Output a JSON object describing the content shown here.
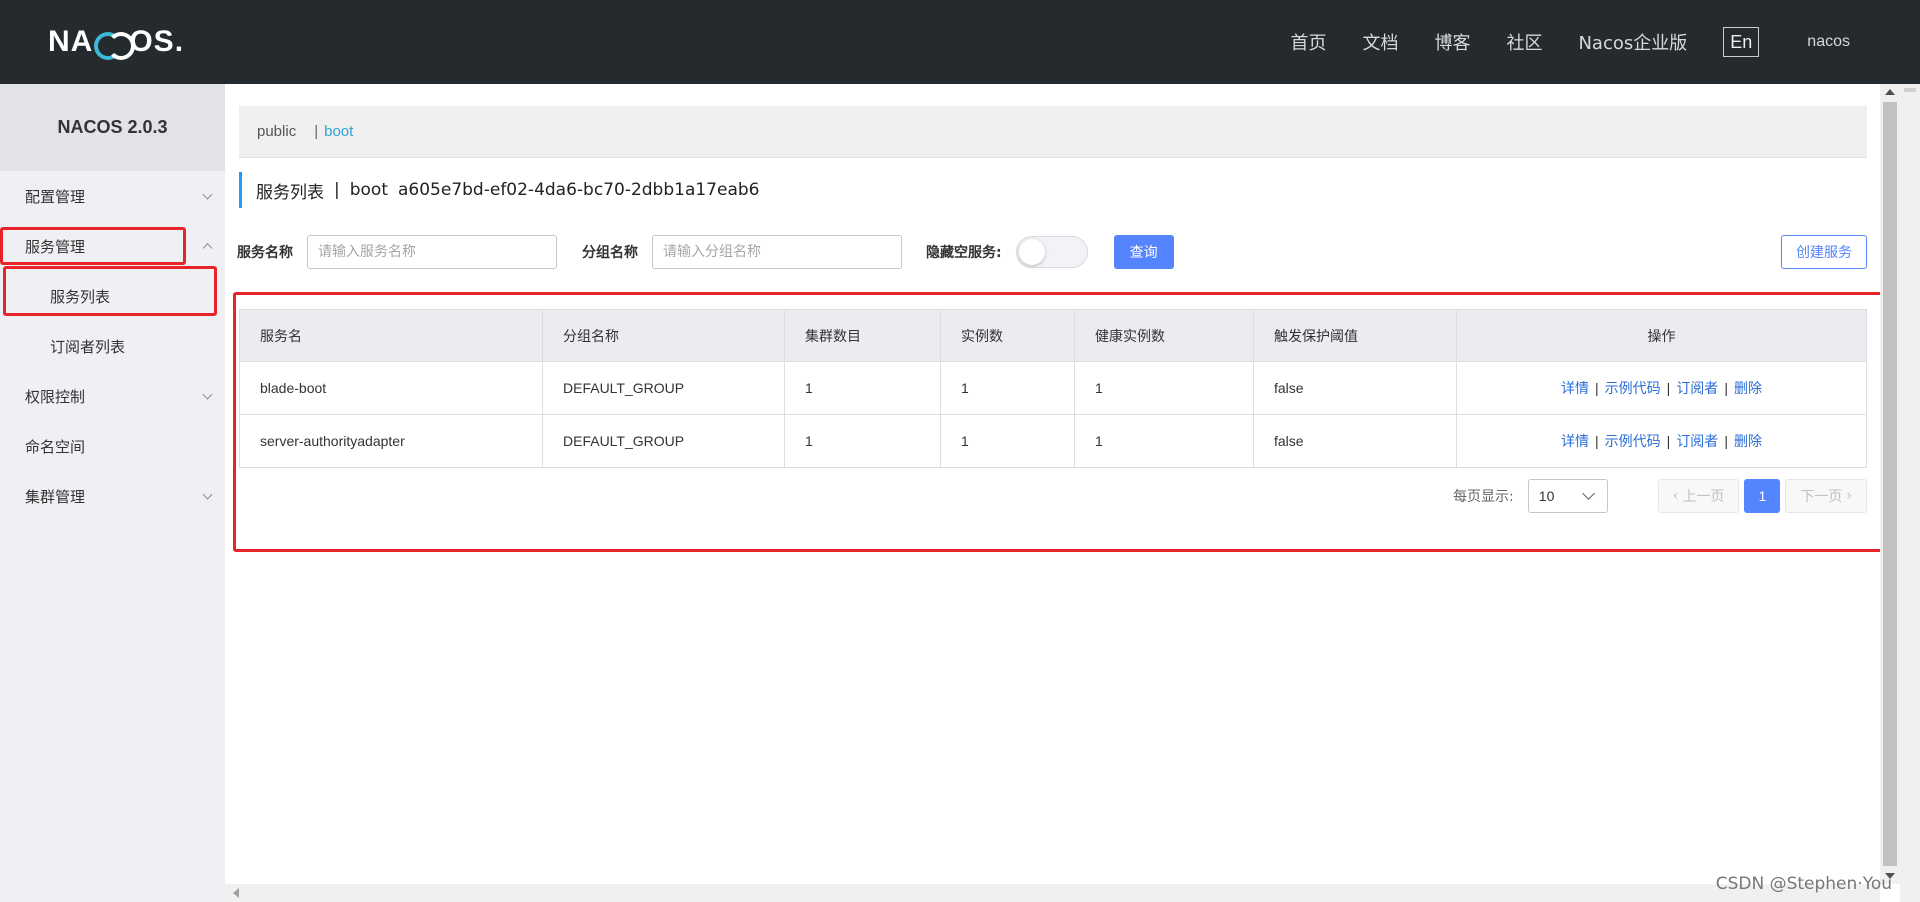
{
  "header": {
    "logo": "NACOS.",
    "nav": [
      "首页",
      "文档",
      "博客",
      "社区",
      "Nacos企业版"
    ],
    "lang": "En",
    "user": "nacos"
  },
  "sidebar": {
    "version": "NACOS 2.0.3",
    "items": [
      {
        "label": "配置管理"
      },
      {
        "label": "服务管理"
      },
      {
        "label": "服务列表"
      },
      {
        "label": "订阅者列表"
      },
      {
        "label": "权限控制"
      },
      {
        "label": "命名空间"
      },
      {
        "label": "集群管理"
      }
    ]
  },
  "breadcrumb": {
    "public": "public",
    "sep": "|",
    "current": "boot"
  },
  "page_title": {
    "prefix": "服务列表",
    "sep": "|",
    "ns_name": "boot",
    "ns_id": "a605e7bd-ef02-4da6-bc70-2dbb1a17eab6"
  },
  "filters": {
    "service_name_label": "服务名称",
    "service_name_placeholder": "请输入服务名称",
    "group_name_label": "分组名称",
    "group_name_placeholder": "请输入分组名称",
    "hide_empty_label": "隐藏空服务:",
    "query_btn": "查询",
    "create_btn": "创建服务"
  },
  "table": {
    "columns": [
      "服务名",
      "分组名称",
      "集群数目",
      "实例数",
      "健康实例数",
      "触发保护阈值",
      "操作"
    ],
    "rows": [
      {
        "name": "blade-boot",
        "group": "DEFAULT_GROUP",
        "clusters": "1",
        "instances": "1",
        "healthy": "1",
        "threshold": "false"
      },
      {
        "name": "server-authorityadapter",
        "group": "DEFAULT_GROUP",
        "clusters": "1",
        "instances": "1",
        "healthy": "1",
        "threshold": "false"
      }
    ],
    "ops": {
      "detail": "详情",
      "sample": "示例代码",
      "subscriber": "订阅者",
      "delete": "删除",
      "sep": "|"
    }
  },
  "pager": {
    "label": "每页显示:",
    "page_size": "10",
    "prev": "上一页",
    "current": "1",
    "next": "下一页"
  },
  "watermark": "CSDN @Stephen·You",
  "colors": {
    "header_bg": "#252a2f",
    "primary": "#5584ff",
    "highlight": "#e8242a",
    "link": "#2b6ed8"
  }
}
